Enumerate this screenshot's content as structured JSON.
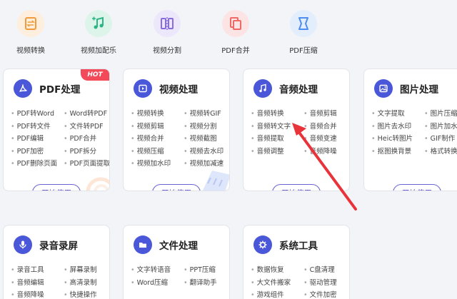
{
  "top_tools": [
    {
      "label": "视频转换",
      "icon": "video-convert-icon",
      "bg": "#fdeede",
      "fg": "#f29b3a"
    },
    {
      "label": "视频加配乐",
      "icon": "music-add-icon",
      "bg": "#ddf4ea",
      "fg": "#2bb584"
    },
    {
      "label": "视频分割",
      "icon": "video-split-icon",
      "bg": "#ece7fb",
      "fg": "#8a6be0"
    },
    {
      "label": "PDF合并",
      "icon": "pdf-merge-icon",
      "bg": "#fde4e4",
      "fg": "#ee6a66"
    },
    {
      "label": "PDF压缩",
      "icon": "pdf-compress-icon",
      "bg": "#e2eefc",
      "fg": "#4d8ef0"
    }
  ],
  "cards": {
    "pdf": {
      "title": "PDF处理",
      "badge": "HOT",
      "button": "开始使用",
      "items": [
        "PDF转Word",
        "Word转PDF",
        "PDF转文件",
        "文件转PDF",
        "PDF编辑",
        "PDF合并",
        "PDF加密",
        "PDF拆分",
        "PDF删除页面",
        "PDF页面提取"
      ]
    },
    "video": {
      "title": "视频处理",
      "button": "开始使用",
      "items": [
        "视频转换",
        "视频转GIF",
        "视频剪辑",
        "视频分割",
        "视频合并",
        "视频截图",
        "视频压缩",
        "视频去水印",
        "视频加水印",
        "视频加减速"
      ]
    },
    "audio": {
      "title": "音频处理",
      "button": "开始使用",
      "items": [
        "音频转换",
        "音频剪辑",
        "音频转文字",
        "音频合并",
        "音频提取",
        "音频变速",
        "音频调整",
        "音频降噪"
      ]
    },
    "image": {
      "title": "图片处理",
      "button": "开始使用",
      "items": [
        "文字提取",
        "图片压缩",
        "图片去水印",
        "图片加水印",
        "Heic转图片",
        "GIF制作",
        "抠图换背景",
        "格式转换"
      ]
    },
    "record": {
      "title": "录音录屏",
      "items": [
        "录音工具",
        "屏幕录制",
        "音频编辑",
        "高清录制",
        "音频降噪",
        "快捷操作"
      ]
    },
    "file": {
      "title": "文件处理",
      "items": [
        "文字转语音",
        "PPT压缩",
        "Word压缩",
        "翻译助手"
      ]
    },
    "system": {
      "title": "系统工具",
      "items": [
        "数据恢复",
        "C盘清理",
        "大文件搬家",
        "驱动管理",
        "游戏组件",
        "文件加密"
      ]
    }
  },
  "colors": {
    "accent": "#4957d8",
    "button_text": "#4b3fc8",
    "hot": "#f34a5a",
    "arrow": "#e8333a"
  }
}
